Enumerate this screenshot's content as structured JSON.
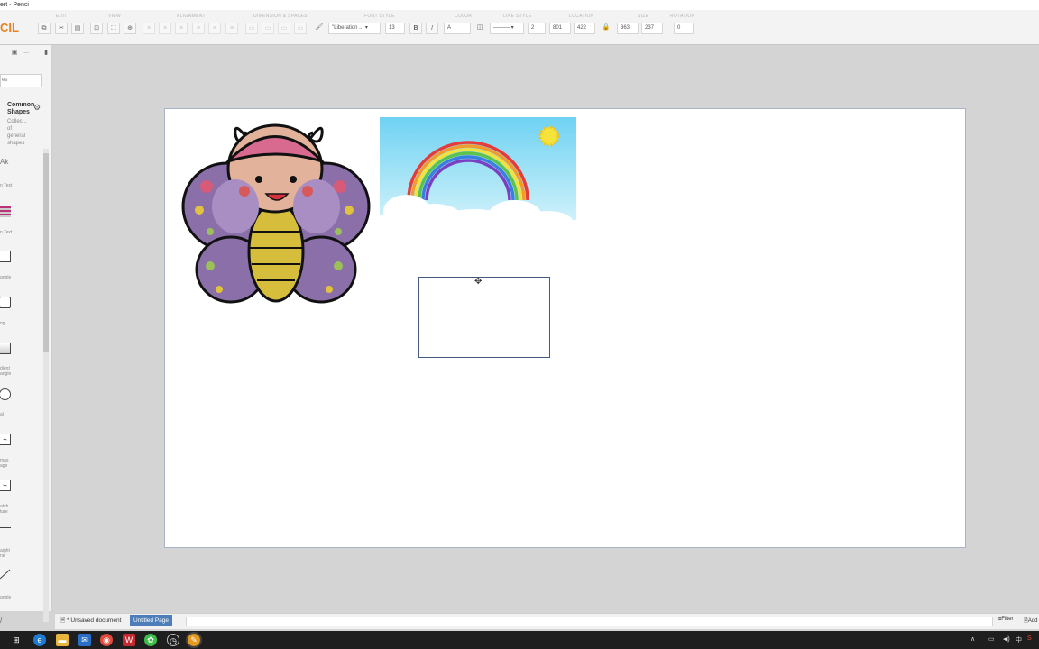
{
  "window": {
    "title": "ert - Penci"
  },
  "app": {
    "logo_text": "CIL"
  },
  "toolbar": {
    "groups": [
      "EDIT",
      "VIEW",
      "ALIGNMENT",
      "DIMENSION & SPACES",
      "FONT STYLE",
      "COLOR",
      "LINE STYLE",
      "LOCATION",
      "SIZE",
      "ROTATION"
    ],
    "font_name": "\"Liberation ...",
    "font_size": "13",
    "bold_label": "B",
    "italic_label": "I",
    "text_color_label": "A",
    "line_width": "2",
    "location_x": "801",
    "location_y": "422",
    "size_w": "363",
    "size_h": "237",
    "rotation": "0"
  },
  "sidebar": {
    "search_value": "es",
    "collection_title": "Common Shapes",
    "collection_desc": "Collec... of general shapes",
    "items": [
      {
        "label": "n Text",
        "kind": "text-icon"
      },
      {
        "label": "n Text",
        "kind": "richtext-icon"
      },
      {
        "label": "angle",
        "kind": "rect"
      },
      {
        "label": "ng...",
        "kind": "rect"
      },
      {
        "label": "dient angle",
        "kind": "rect"
      },
      {
        "label": "al",
        "kind": "ellipse"
      },
      {
        "label": "mas age",
        "kind": "bitmap-icon"
      },
      {
        "label": "atch ture",
        "kind": "bitmap-icon"
      },
      {
        "label": "aight ne",
        "kind": "line"
      },
      {
        "label": "angle",
        "kind": "triangle"
      }
    ]
  },
  "status": {
    "document": "* Unsaved document",
    "page_tab": "Untitled Page",
    "filter_label": "Filter",
    "add_label": "Add"
  },
  "taskbar": {
    "apps": [
      "start",
      "edge",
      "files",
      "mail",
      "chrome",
      "wps",
      "wechat",
      "clock",
      "pencil"
    ],
    "tray_lang": "中"
  },
  "colors": {
    "accent": "#4d7eb9",
    "logo": "#e8821e",
    "taskbar": "#1e1e1e"
  }
}
